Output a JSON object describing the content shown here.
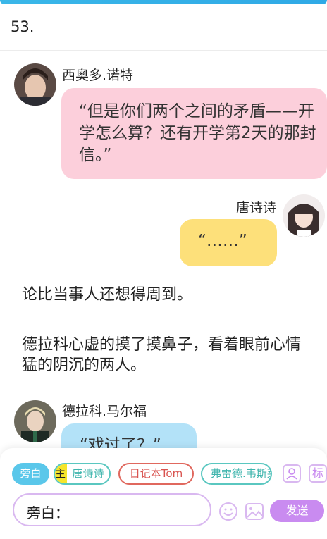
{
  "chapter_number": "53.",
  "messages": [
    {
      "speaker": "西奥多.诺特",
      "text": "“但是你们两个之间的矛盾——开学怎么算？还有开学第2天的那封信。”"
    },
    {
      "speaker": "唐诗诗",
      "text": "“……”"
    },
    {
      "narration": "论比当事人还想得周到。"
    },
    {
      "narration": "德拉科心虚的摸了摸鼻子，看着眼前心情猛的阴沉的两人。"
    },
    {
      "speaker": "德拉科.马尔福",
      "text": "“戏过了？”"
    }
  ],
  "role_bar": {
    "narrator_label": "旁白",
    "main_badge": "主",
    "roles": [
      "唐诗诗",
      "日记本Tom",
      "弗雷德.韦斯莱"
    ],
    "extra_label": "标"
  },
  "input": {
    "prefix": "旁白："
  },
  "send_label": "发送",
  "colors": {
    "theodore_bubble": "#fccfdb",
    "tangshishi_bubble": "#fde07a",
    "draco_bubble": "#b3e2f8",
    "accent_purple": "#c98bf0",
    "narrator_chip": "#5ac7ea",
    "tangshishi_chip_border": "#5ac7c0",
    "tom_chip_border": "#e0685e",
    "fred_chip_border": "#5ac7c0"
  }
}
